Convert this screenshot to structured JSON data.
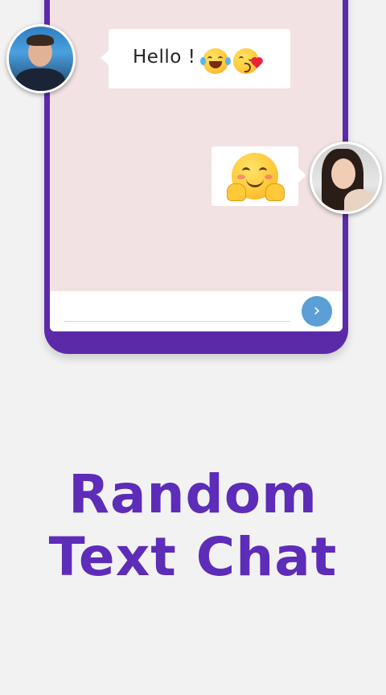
{
  "chat": {
    "incoming_message": "Hello !",
    "incoming_emojis": [
      "face-with-tears-of-joy",
      "face-throwing-kiss"
    ],
    "outgoing_emojis": [
      "hugging-face"
    ],
    "input_placeholder": "",
    "send_icon": "›"
  },
  "headline": {
    "line1": "Random",
    "line2": "Text Chat"
  },
  "colors": {
    "phone_frame": "#5b2aa8",
    "screen_bg": "#f3e2e3",
    "headline": "#5d2cb8",
    "send_button": "#5b9fd6",
    "page_bg": "#f2f2f2"
  }
}
